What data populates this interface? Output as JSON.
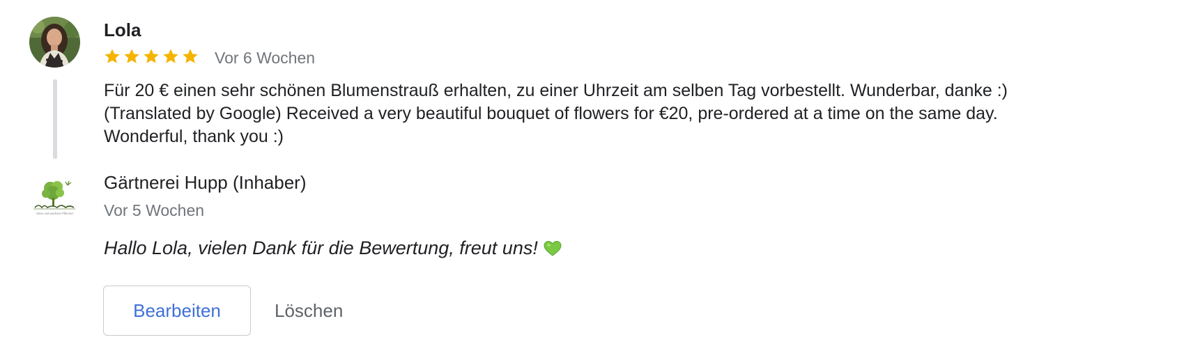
{
  "review": {
    "reviewer_name": "Lola",
    "rating": 5,
    "rating_max": 5,
    "star_color": "#f4b400",
    "date": "Vor 6 Wochen",
    "text_lines": [
      "Für 20 € einen sehr schönen Blumenstrauß erhalten, zu einer Uhrzeit am selben Tag vorbestellt. Wunderbar, danke :)",
      "(Translated by Google) Received a very beautiful bouquet of flowers for €20, pre-ordered at a time on the same day.",
      "Wonderful, thank you :)"
    ]
  },
  "owner_reply": {
    "owner_name": "Gärtnerei Hupp (Inhaber)",
    "date": "Vor 5 Wochen",
    "text": "Hallo Lola, vielen Dank für die Bewertung, freut uns!",
    "emoji": "green-heart-icon",
    "logo_caption": "Leben und wachsen Pflanzen"
  },
  "actions": {
    "edit_label": "Bearbeiten",
    "delete_label": "Löschen",
    "edit_color": "#3f6fd8"
  }
}
